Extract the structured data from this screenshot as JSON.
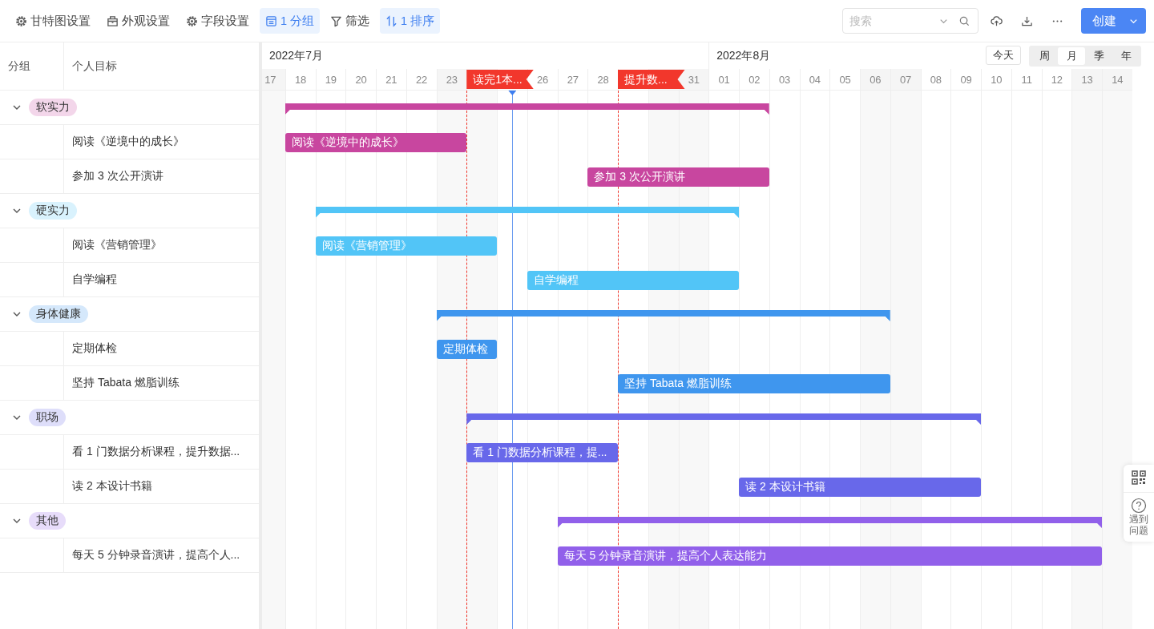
{
  "toolbar": {
    "items": [
      {
        "label": "甘特图设置",
        "selected": false
      },
      {
        "label": "外观设置",
        "selected": false
      },
      {
        "label": "字段设置",
        "selected": false
      },
      {
        "label": "1 分组",
        "selected": true
      },
      {
        "label": "筛选",
        "selected": false
      },
      {
        "label": "1 排序",
        "selected": true
      }
    ],
    "search": {
      "placeholder": "搜索"
    },
    "create_button": "创建"
  },
  "table": {
    "columns": [
      "分组",
      "个人目标"
    ]
  },
  "timeline": {
    "months": [
      "2022年7月",
      "2022年8月"
    ],
    "today_button": "今天",
    "views": [
      {
        "label": "周",
        "selected": false
      },
      {
        "label": "月",
        "selected": true
      },
      {
        "label": "季",
        "selected": false
      },
      {
        "label": "年",
        "selected": false
      }
    ],
    "days": [
      "17",
      "18",
      "19",
      "20",
      "21",
      "22",
      "23",
      "26",
      "27",
      "28",
      "31",
      "01",
      "02",
      "03",
      "04",
      "05",
      "06",
      "07",
      "08",
      "09",
      "10",
      "11",
      "12",
      "13",
      "14"
    ],
    "milestones": [
      "读完1本...",
      "提升数..."
    ]
  },
  "groups": [
    {
      "name": "软实力",
      "color": "#c8469f",
      "expanded": true,
      "tasks": [
        {
          "name": "阅读《逆境中的成长》",
          "bar_label": "阅读《逆境中的成长》"
        },
        {
          "name": "参加 3 次公开演讲",
          "bar_label": "参加 3 次公开演讲"
        }
      ]
    },
    {
      "name": "硬实力",
      "color": "#52c5f7",
      "expanded": true,
      "tasks": [
        {
          "name": "阅读《营销管理》",
          "bar_label": "阅读《营销管理》"
        },
        {
          "name": "自学编程",
          "bar_label": "自学编程"
        }
      ]
    },
    {
      "name": "身体健康",
      "color": "#3f96ee",
      "expanded": true,
      "tasks": [
        {
          "name": "定期体检",
          "bar_label": "定期体检"
        },
        {
          "name": "坚持 Tabata 燃脂训练",
          "bar_label": "坚持 Tabata 燃脂训练"
        }
      ]
    },
    {
      "name": "职场",
      "color": "#6868ea",
      "expanded": true,
      "tasks": [
        {
          "name": "看 1 门数据分析课程，提升数据...",
          "bar_label": "看 1 门数据分析课程，提..."
        },
        {
          "name": "读 2 本设计书籍",
          "bar_label": "读 2 本设计书籍"
        }
      ]
    },
    {
      "name": "其他",
      "color": "#9160ea",
      "expanded": true,
      "tasks": [
        {
          "name": "每天 5 分钟录音演讲，提高个人...",
          "bar_label": "每天 5 分钟录音演讲，提高个人表达能力"
        }
      ]
    }
  ],
  "help": {
    "label": "遇到问题"
  }
}
